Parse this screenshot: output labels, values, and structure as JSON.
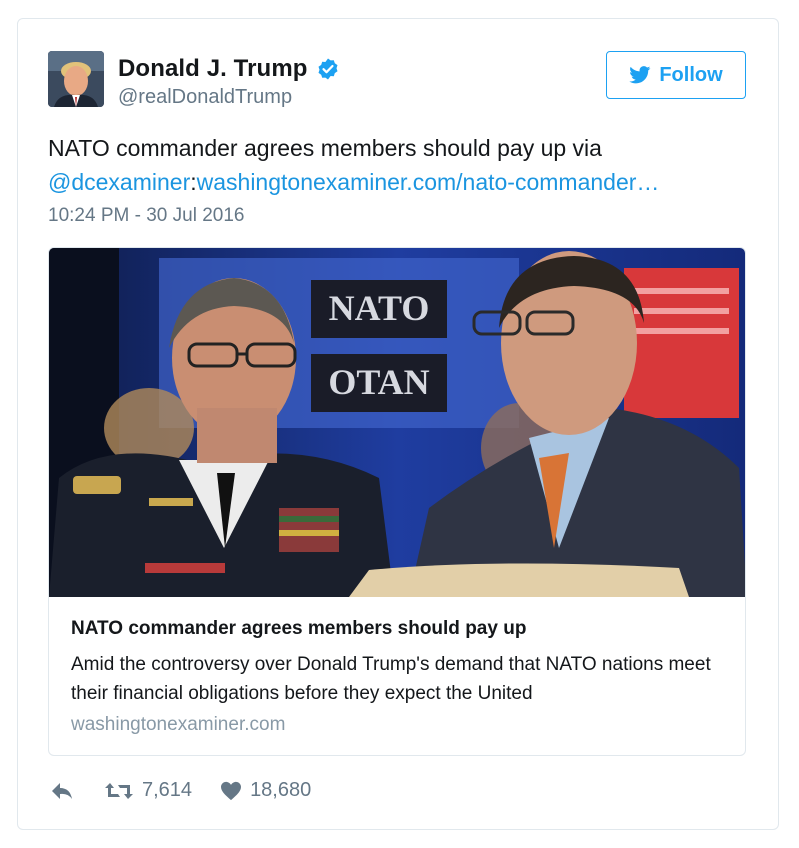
{
  "author": {
    "display_name": "Donald J. Trump",
    "handle": "@realDonaldTrump",
    "verified": true
  },
  "follow_label": "Follow",
  "tweet": {
    "text_prefix": "NATO commander agrees members should pay up via",
    "mention": "@dcexaminer",
    "separator": ":",
    "link": "washingtonexaminer.com/nato-commander…",
    "timestamp": "10:24 PM - 30 Jul 2016"
  },
  "card": {
    "image_text_top": "NATO",
    "image_text_bottom": "OTAN",
    "title": "NATO commander agrees members should pay up",
    "description": "Amid the controversy over Donald Trump's demand that NATO nations meet their financial obligations before they expect the United",
    "domain": "washingtonexaminer.com"
  },
  "stats": {
    "retweets": "7,614",
    "likes": "18,680"
  },
  "colors": {
    "accent": "#1da1f2",
    "link": "#1b95e0",
    "muted": "#657786"
  }
}
